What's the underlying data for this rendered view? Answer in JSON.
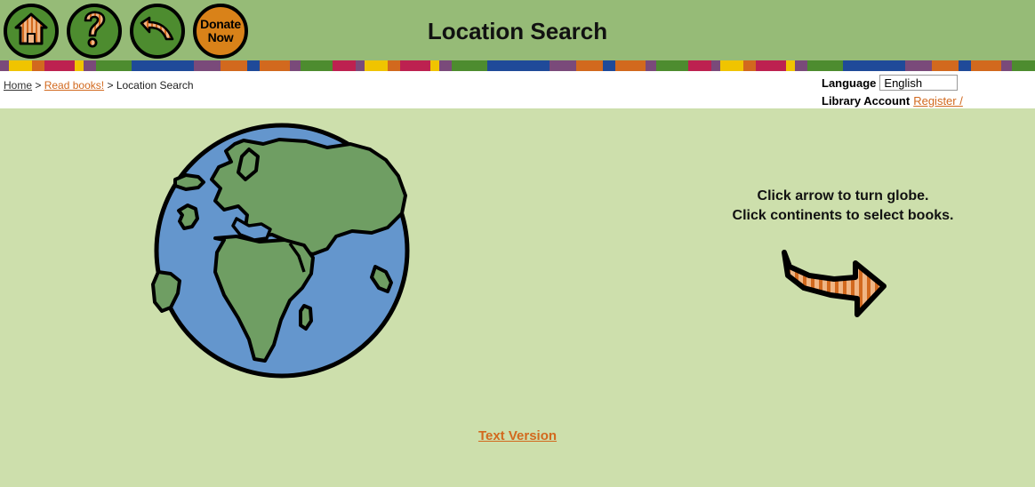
{
  "header": {
    "title": "Location Search",
    "background_color": "#96bb77",
    "buttons": [
      {
        "name": "home",
        "icon": "house-icon",
        "label": "",
        "style": "green"
      },
      {
        "name": "help",
        "icon": "question-mark-icon",
        "label": "",
        "style": "green"
      },
      {
        "name": "back",
        "icon": "back-arrow-icon",
        "label": "",
        "style": "green"
      },
      {
        "name": "donate",
        "icon": "donate-icon",
        "label": "Donate\nNow",
        "label_line1": "Donate",
        "label_line2": "Now",
        "style": "orange"
      }
    ]
  },
  "stripe_band": {
    "colors": [
      "#7a4a7a",
      "#f0c400",
      "#d2691e",
      "#bd2150",
      "#f0c400",
      "#7a4a7a",
      "#4d8c2f",
      "#1f4a99",
      "#1f4a99",
      "#7a4a7a",
      "#d2691e",
      "#1f4a99",
      "#d2691e",
      "#7a4a7a",
      "#4d8c2f",
      "#bd2150"
    ]
  },
  "breadcrumb": {
    "home": "Home",
    "separator_1": ">",
    "read_books": "Read books!",
    "separator_2": ">",
    "current": "Location Search"
  },
  "account_bar": {
    "language_label": "Language",
    "language_value": "English",
    "library_account_label": "Library Account",
    "register_link": "Register / "
  },
  "main": {
    "hint_line_1": "Click arrow to turn globe.",
    "hint_line_2": "Click continents to select books.",
    "text_version_link": "Text Version",
    "globe": {
      "name": "world-globe",
      "ocean_color": "#6496cd",
      "land_color": "#6f9e63",
      "outline_color": "#000000"
    },
    "arrow": {
      "name": "turn-globe-arrow",
      "fill_light": "#f0b584",
      "fill_dark": "#d2691e",
      "outline_color": "#000000",
      "direction": "right"
    },
    "background_color": "#cddfac"
  }
}
